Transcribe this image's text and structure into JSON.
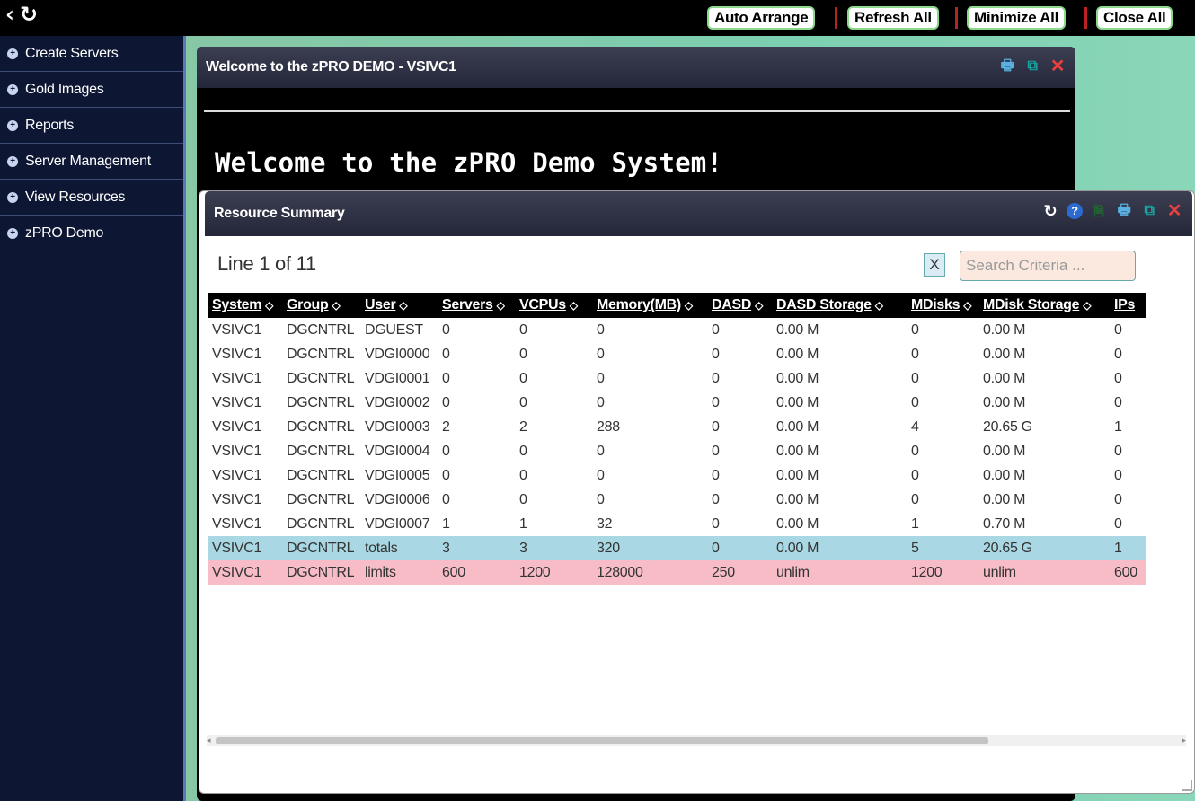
{
  "topbar": {
    "back_icon": "chevron-left-icon",
    "refresh_icon": "refresh-icon",
    "buttons": [
      "Auto Arrange",
      "Refresh All",
      "Minimize All",
      "Close All"
    ]
  },
  "sidebar": {
    "items": [
      {
        "label": "Create Servers"
      },
      {
        "label": "Gold Images"
      },
      {
        "label": "Reports"
      },
      {
        "label": "Server Management"
      },
      {
        "label": "View Resources"
      },
      {
        "label": "zPRO Demo"
      }
    ]
  },
  "welcome_window": {
    "title": "Welcome to the zPRO DEMO - VSIVC1",
    "message": "Welcome to the zPRO Demo System!"
  },
  "resource_window": {
    "title": "Resource Summary",
    "line_count": "Line 1 of 11",
    "clear_label": "X",
    "search_placeholder": "Search Criteria ...",
    "columns": [
      "System",
      "Group",
      "User",
      "Servers",
      "VCPUs",
      "Memory(MB)",
      "DASD",
      "DASD Storage",
      "MDisks",
      "MDisk Storage",
      "IPs"
    ],
    "rows": [
      [
        "VSIVC1",
        "DGCNTRL",
        "DGUEST",
        "0",
        "0",
        "0",
        "0",
        "0.00 M",
        "0",
        "0.00 M",
        "0"
      ],
      [
        "VSIVC1",
        "DGCNTRL",
        "VDGI0000",
        "0",
        "0",
        "0",
        "0",
        "0.00 M",
        "0",
        "0.00 M",
        "0"
      ],
      [
        "VSIVC1",
        "DGCNTRL",
        "VDGI0001",
        "0",
        "0",
        "0",
        "0",
        "0.00 M",
        "0",
        "0.00 M",
        "0"
      ],
      [
        "VSIVC1",
        "DGCNTRL",
        "VDGI0002",
        "0",
        "0",
        "0",
        "0",
        "0.00 M",
        "0",
        "0.00 M",
        "0"
      ],
      [
        "VSIVC1",
        "DGCNTRL",
        "VDGI0003",
        "2",
        "2",
        "288",
        "0",
        "0.00 M",
        "4",
        "20.65 G",
        "1"
      ],
      [
        "VSIVC1",
        "DGCNTRL",
        "VDGI0004",
        "0",
        "0",
        "0",
        "0",
        "0.00 M",
        "0",
        "0.00 M",
        "0"
      ],
      [
        "VSIVC1",
        "DGCNTRL",
        "VDGI0005",
        "0",
        "0",
        "0",
        "0",
        "0.00 M",
        "0",
        "0.00 M",
        "0"
      ],
      [
        "VSIVC1",
        "DGCNTRL",
        "VDGI0006",
        "0",
        "0",
        "0",
        "0",
        "0.00 M",
        "0",
        "0.00 M",
        "0"
      ],
      [
        "VSIVC1",
        "DGCNTRL",
        "VDGI0007",
        "1",
        "1",
        "32",
        "0",
        "0.00 M",
        "1",
        "0.70 M",
        "0"
      ],
      [
        "VSIVC1",
        "DGCNTRL",
        "totals",
        "3",
        "3",
        "320",
        "0",
        "0.00 M",
        "5",
        "20.65 G",
        "1"
      ],
      [
        "VSIVC1",
        "DGCNTRL",
        "limits",
        "600",
        "1200",
        "128000",
        "250",
        "unlim",
        "1200",
        "unlim",
        "600"
      ]
    ],
    "colors": {
      "totals_row": "#a9d8e4",
      "limits_row": "#f7bcc6"
    }
  }
}
